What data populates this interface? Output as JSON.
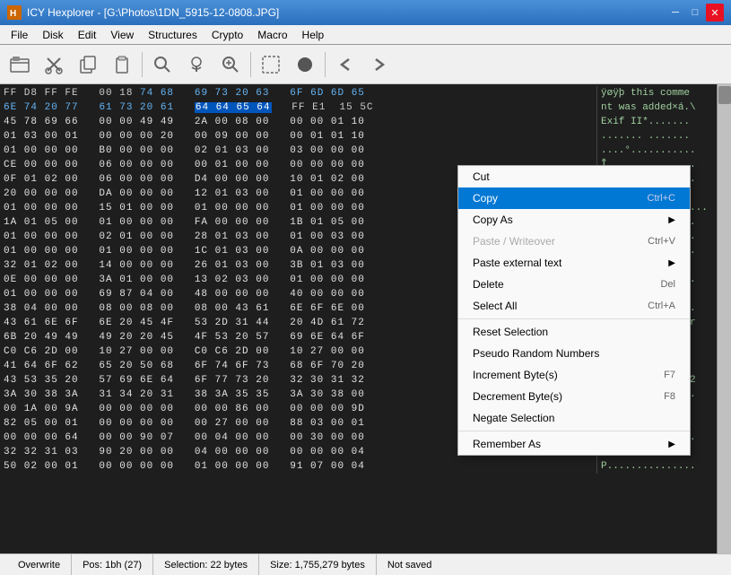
{
  "window": {
    "title": "ICY Hexplorer - [G:\\Photos\\1DN_5915-12-0808.JPG]",
    "icon": "🔷"
  },
  "title_controls": {
    "minimize": "─",
    "maximize": "□",
    "close": "✕"
  },
  "menu": {
    "items": [
      "File",
      "Disk",
      "Edit",
      "View",
      "Structures",
      "Crypto",
      "Macro",
      "Help"
    ]
  },
  "toolbar": {
    "buttons": [
      "📂",
      "✂",
      "📋",
      "📄",
      "🔍",
      "🔧",
      "🔍",
      "⛶",
      "⬤",
      "◀",
      "▶"
    ]
  },
  "hex_data": {
    "rows": [
      {
        "offset": "FF D8 FF FE",
        "bytes": "00 18 74 68  69 73 20 63  6F 6D 6D 65",
        "ascii": "ÿøÿþ  this comme"
      },
      {
        "offset": "6E 74 20 77",
        "bytes": "61 73 20 61  64 64 65 64  FF E1 15 5C",
        "ascii": "nt was added×á.\\"
      },
      {
        "offset": "45 78 69 66",
        "bytes": "00 00 49 49  2A 00 08 00  00 00 01 10",
        "ascii": "Exif  II*......."
      },
      {
        "offset": "01 03 00 01",
        "bytes": "00 00 00 20  00 09 00 00  00 01 01 10",
        "ascii": ".......  ......."
      },
      {
        "offset": "01 00 00 00",
        "bytes": "B0 00 00 00  02 01 03 00  03 00 00 00",
        "ascii": "....°..........."
      },
      {
        "offset": "CE 00 00 00",
        "bytes": "06 00 00 00  00 01 00 00  00 00 00 00",
        "ascii": "Î..............."
      },
      {
        "offset": "0F 01 02 00",
        "bytes": "06 00 00 00  D4 00 00 00  10 01 02 00",
        "ascii": "......Ô........."
      },
      {
        "offset": "20 00 00 00",
        "bytes": "DA 00 00 00  12 01 03 00  01 00 00 00",
        "ascii": " ...Ú..........."
      },
      {
        "offset": "01 00 00 00",
        "bytes": "15 01 00 00  01 00 00 00  01 00 00 00",
        "ascii": "................"
      },
      {
        "offset": "1A 01 05 00",
        "bytes": "01 00 00 00  FA 00 00 00  1B 01 05 00",
        "ascii": "....ú..........."
      },
      {
        "offset": "01 00 00 00",
        "bytes": "02 01 00 00  28 01 03 00  01 00 03 00",
        "ascii": ".......(........"
      },
      {
        "offset": "01 00 00 00",
        "bytes": "01 00 00 00  1C 01 03 00  0A 00 00 00",
        "ascii": "................"
      },
      {
        "offset": "32 01 02 00",
        "bytes": "14 00 00 00  26 01 03 00  3B 01 03 00",
        "ascii": "2...&...; ......"
      },
      {
        "offset": "0E 00 00 00",
        "bytes": "3A 01 00 00  13 02 03 00  01 00 00 00",
        "ascii": "..:....2........"
      },
      {
        "offset": "01 00 00 00",
        "bytes": "69 87 04 00  48 00 00 00  40 00 00 00",
        "ascii": "....i..H...@...."
      },
      {
        "offset": "38 04 00 00",
        "bytes": "08 00 08 00  08 00 43 61  6E 6F 6E 00",
        "ascii": "8.....Canon....."
      },
      {
        "offset": "43 61 6E 6F",
        "bytes": "6E 20 45 4F  53 2D 31 44  20 4D 61 72",
        "ascii": "Canon EOS-1D Mar"
      },
      {
        "offset": "6B 20 49 49",
        "bytes": "49 20 20 45  4F 53 20 57  69 6E 64 6F",
        "ascii": "k III  EOS Windo"
      },
      {
        "offset": "C0 C6 2D 00",
        "bytes": "10 27 00 00  C0 C6 2D 00  10 27 00 00",
        "ascii": "ÀÆ-..'.ÀÆ-..'. ."
      },
      {
        "offset": "41 64 6F 62",
        "bytes": "65 20 50 68  6F 74 6F 73  68 6F 70 20",
        "ascii": "Adobe Photoshop "
      },
      {
        "offset": "43 53 35 20",
        "bytes": "57 69 6E 64  6F 77 73 20  32 30 31 32",
        "ascii": "CS5 Windows 2012"
      },
      {
        "offset": "3A 30 38 3A",
        "bytes": "31 34 20 31  38 3A 35 35  3A 30 38 00",
        "ascii": ":08:14 18:55:08."
      },
      {
        "offset": "00 1A 00 9A",
        "bytes": "00 00 00 00  00 00 86 00  00 00 00 9D",
        "ascii": "..............→ ‖"
      },
      {
        "offset": "82 05 00 01",
        "bytes": "00 00 00 00  00 27 00 00  88 03 00 01",
        "ascii": "..I..I.'......."
      },
      {
        "offset": "00 00 00 64",
        "bytes": "00 00 90 07  00 04 00 00  00 30 00 00",
        "ascii": "...d.......0...."
      },
      {
        "offset": "32 32 31 03",
        "bytes": "90 20 00 00  04 00 00 00  00 00 00 04",
        "ascii": "221. ..........."
      },
      {
        "offset": "50 02 00 01",
        "bytes": "00 00 00 00  01 00 00 00  91 07 00 04",
        "ascii": "P..............."
      }
    ]
  },
  "context_menu": {
    "items": [
      {
        "label": "Cut",
        "shortcut": ""
      },
      {
        "label": "Copy",
        "shortcut": "Ctrl+C",
        "active": true
      },
      {
        "label": "Copy As",
        "shortcut": "",
        "arrow": "▶"
      },
      {
        "label": "Paste / Writeover",
        "shortcut": "Ctrl+V",
        "disabled": true
      },
      {
        "label": "Paste external text",
        "shortcut": "",
        "arrow": "▶"
      },
      {
        "label": "Delete",
        "shortcut": "Del"
      },
      {
        "label": "Select All",
        "shortcut": "Ctrl+A"
      },
      {
        "sep": true
      },
      {
        "label": "Reset Selection",
        "shortcut": ""
      },
      {
        "label": "Pseudo Random Numbers",
        "shortcut": ""
      },
      {
        "label": "Increment Byte(s)",
        "shortcut": "F7"
      },
      {
        "label": "Decrement Byte(s)",
        "shortcut": "F8"
      },
      {
        "label": "Negate Selection",
        "shortcut": ""
      },
      {
        "sep": true
      },
      {
        "label": "Remember As",
        "shortcut": "",
        "arrow": "▶"
      }
    ]
  },
  "status": {
    "mode": "Overwrite",
    "position": "Pos: 1bh (27)",
    "selection": "Selection: 22 bytes",
    "size": "Size: 1,755,279 bytes",
    "save_state": "Not saved"
  }
}
